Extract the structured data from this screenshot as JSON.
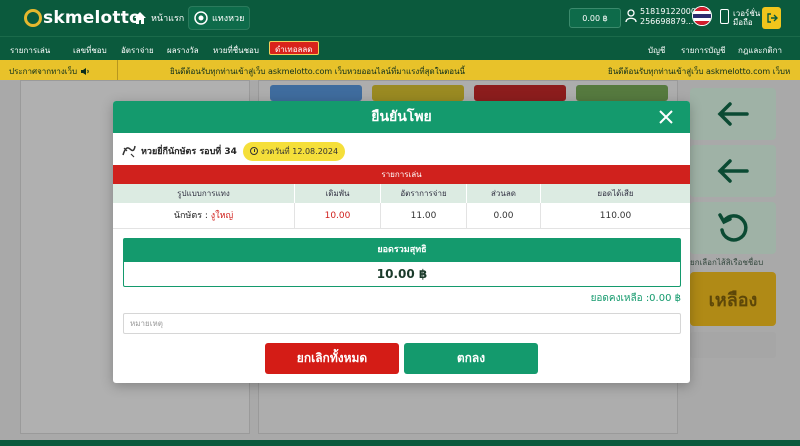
{
  "header": {
    "logo_text": "skmelotto",
    "home_label": "หน้าแรก",
    "bet_label": "แทงหวย",
    "balance": "0.00 ฿",
    "user_id": "51819122000",
    "user_phone": "256698879...",
    "phone_label_1": "เวอร์ชั่น",
    "phone_label_2": "มือถือ"
  },
  "menu": {
    "items": [
      "รายการเล่น",
      "เลขที่ชอบ",
      "อัตราจ่าย",
      "ผลรางวัล",
      "หวยที่ชื่นชอบ"
    ],
    "hot_label": "ดำเทอลลด",
    "right_items": [
      "บัญชี",
      "รายการบัญชี",
      "กฎและกติกา"
    ]
  },
  "announcement": {
    "label": "ประกาศจากทางเว็บ",
    "text_1": "ยินดีต้อนรับทุกท่านเข้าสู่เว็บ askmelotto.com เว็บหวยออนไลน์ที่มาแรงที่สุดในตอนนี้",
    "text_2": "ยินดีต้อนรับทุกท่านเข้าสู่เว็บ askmelotto.com เว็บห"
  },
  "side": {
    "link_text": "ยกเลือกไส้สิเรือชชื่อบ",
    "gold_button": "เหลือง"
  },
  "modal": {
    "title": "ยืนยันโพย",
    "lotto_name": "หวยยี่กีนักษัตร รอบที่ 34",
    "date_label": "งวดวันที่ 12.08.2024",
    "list_header": "รายการเล่น",
    "columns": [
      "รูปแบบการแทง",
      "เดิมพัน",
      "อัตราการจ่าย",
      "ส่วนลด",
      "ยอดได้เสีย"
    ],
    "row": {
      "type_label": "นักษัตร :",
      "type_value": "งูใหญ่",
      "stake": "10.00",
      "rate": "11.00",
      "discount": "0.00",
      "payout": "110.00"
    },
    "total_label": "ยอดรวมสุทธิ",
    "total_value": "10.00 ฿",
    "remaining": "ยอดคงเหลือ :0.00 ฿",
    "note_placeholder": "หมายเหตุ",
    "cancel_label": "ยกเลิกทั้งหมด",
    "ok_label": "ตกลง"
  },
  "colors": {
    "brand_green": "#0b5a3d",
    "modal_green": "#149a6d",
    "danger_red": "#d0211d",
    "accent_yellow": "#e8c22a"
  }
}
